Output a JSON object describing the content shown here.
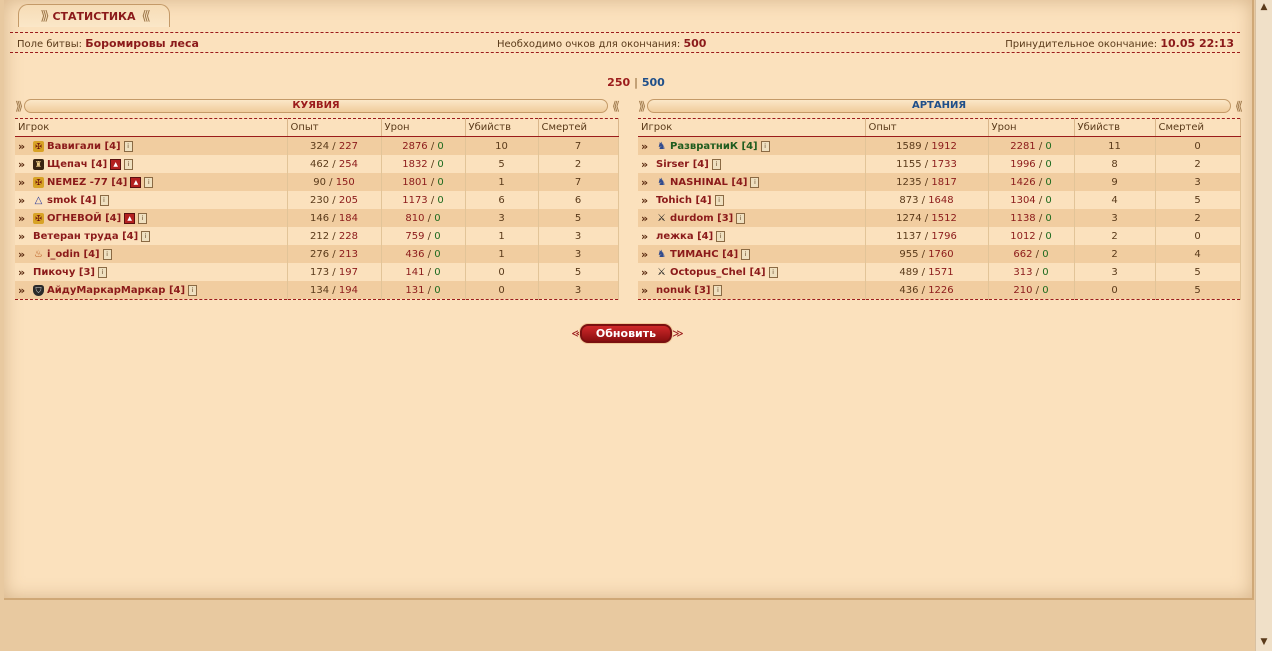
{
  "tab": {
    "title": "СТАТИСТИКА"
  },
  "info": {
    "field_label": "Поле битвы:",
    "field_value": "Боромировы леса",
    "points_label": "Необходимо очков для окончания:",
    "points_value": "500",
    "forced_label": "Принудительное окончание:",
    "forced_value": "10.05 22:13"
  },
  "score": {
    "left": "250",
    "sep": "|",
    "right": "500"
  },
  "columns": [
    "Игрок",
    "Опыт",
    "Урон",
    "Убийств",
    "Смертей"
  ],
  "teams": [
    {
      "name": "КУЯВИЯ",
      "color": "#9b1b1b",
      "players": [
        {
          "name": "Вавигали",
          "level": "[4]",
          "badge": "clan-y",
          "rank": false,
          "exp_a": "324",
          "exp_b": "227",
          "dmg_a": "2876",
          "dmg_b": "0",
          "kills": "10",
          "deaths": "7"
        },
        {
          "name": "Щепач",
          "level": "[4]",
          "badge": "clan-b",
          "rank": true,
          "exp_a": "462",
          "exp_b": "254",
          "dmg_a": "1832",
          "dmg_b": "0",
          "kills": "5",
          "deaths": "2"
        },
        {
          "name": "NEMEZ -77",
          "level": "[4]",
          "badge": "clan-y",
          "rank": true,
          "exp_a": "90",
          "exp_b": "150",
          "dmg_a": "1801",
          "dmg_b": "0",
          "kills": "1",
          "deaths": "7"
        },
        {
          "name": "smok",
          "level": "[4]",
          "badge": "clan-tri",
          "rank": false,
          "exp_a": "230",
          "exp_b": "205",
          "dmg_a": "1173",
          "dmg_b": "0",
          "kills": "6",
          "deaths": "6"
        },
        {
          "name": "ОГНЕВОЙ",
          "level": "[4]",
          "badge": "clan-y",
          "rank": true,
          "exp_a": "146",
          "exp_b": "184",
          "dmg_a": "810",
          "dmg_b": "0",
          "kills": "3",
          "deaths": "5"
        },
        {
          "name": "Ветеран труда",
          "level": "[4]",
          "badge": "",
          "rank": false,
          "exp_a": "212",
          "exp_b": "228",
          "dmg_a": "759",
          "dmg_b": "0",
          "kills": "1",
          "deaths": "3"
        },
        {
          "name": "i_odin",
          "level": "[4]",
          "badge": "clan-fire",
          "rank": false,
          "exp_a": "276",
          "exp_b": "213",
          "dmg_a": "436",
          "dmg_b": "0",
          "kills": "1",
          "deaths": "3"
        },
        {
          "name": "Пикочу",
          "level": "[3]",
          "badge": "",
          "rank": false,
          "exp_a": "173",
          "exp_b": "197",
          "dmg_a": "141",
          "dmg_b": "0",
          "kills": "0",
          "deaths": "5"
        },
        {
          "name": "АйдуМаркарМаркар",
          "level": "[4]",
          "badge": "clan-shield",
          "rank": false,
          "exp_a": "134",
          "exp_b": "194",
          "dmg_a": "131",
          "dmg_b": "0",
          "kills": "0",
          "deaths": "3"
        }
      ]
    },
    {
      "name": "АРТАНИЯ",
      "color": "#1f4f8a",
      "players": [
        {
          "name": "РазвратниК",
          "level": "[4]",
          "badge": "clan-wolf",
          "rank": false,
          "green": true,
          "exp_a": "1589",
          "exp_b": "1912",
          "dmg_a": "2281",
          "dmg_b": "0",
          "kills": "11",
          "deaths": "0"
        },
        {
          "name": "Sirser",
          "level": "[4]",
          "badge": "",
          "rank": false,
          "exp_a": "1155",
          "exp_b": "1733",
          "dmg_a": "1996",
          "dmg_b": "0",
          "kills": "8",
          "deaths": "2"
        },
        {
          "name": "NASHINAL",
          "level": "[4]",
          "badge": "clan-wolf",
          "rank": false,
          "exp_a": "1235",
          "exp_b": "1817",
          "dmg_a": "1426",
          "dmg_b": "0",
          "kills": "9",
          "deaths": "3"
        },
        {
          "name": "Tohich",
          "level": "[4]",
          "badge": "",
          "rank": false,
          "exp_a": "873",
          "exp_b": "1648",
          "dmg_a": "1304",
          "dmg_b": "0",
          "kills": "4",
          "deaths": "5"
        },
        {
          "name": "durdom",
          "level": "[3]",
          "badge": "clan-sword",
          "rank": false,
          "exp_a": "1274",
          "exp_b": "1512",
          "dmg_a": "1138",
          "dmg_b": "0",
          "kills": "3",
          "deaths": "2"
        },
        {
          "name": "лежка",
          "level": "[4]",
          "badge": "",
          "rank": false,
          "exp_a": "1137",
          "exp_b": "1796",
          "dmg_a": "1012",
          "dmg_b": "0",
          "kills": "2",
          "deaths": "0"
        },
        {
          "name": "ТИМАНС",
          "level": "[4]",
          "badge": "clan-wolf",
          "rank": false,
          "exp_a": "955",
          "exp_b": "1760",
          "dmg_a": "662",
          "dmg_b": "0",
          "kills": "2",
          "deaths": "4"
        },
        {
          "name": "Octopus_Chel",
          "level": "[4]",
          "badge": "clan-sword",
          "rank": false,
          "exp_a": "489",
          "exp_b": "1571",
          "dmg_a": "313",
          "dmg_b": "0",
          "kills": "3",
          "deaths": "5"
        },
        {
          "name": "nonuk",
          "level": "[3]",
          "badge": "",
          "rank": false,
          "exp_a": "436",
          "exp_b": "1226",
          "dmg_a": "210",
          "dmg_b": "0",
          "kills": "0",
          "deaths": "5"
        }
      ]
    }
  ],
  "refresh": {
    "label": "Обновить"
  }
}
